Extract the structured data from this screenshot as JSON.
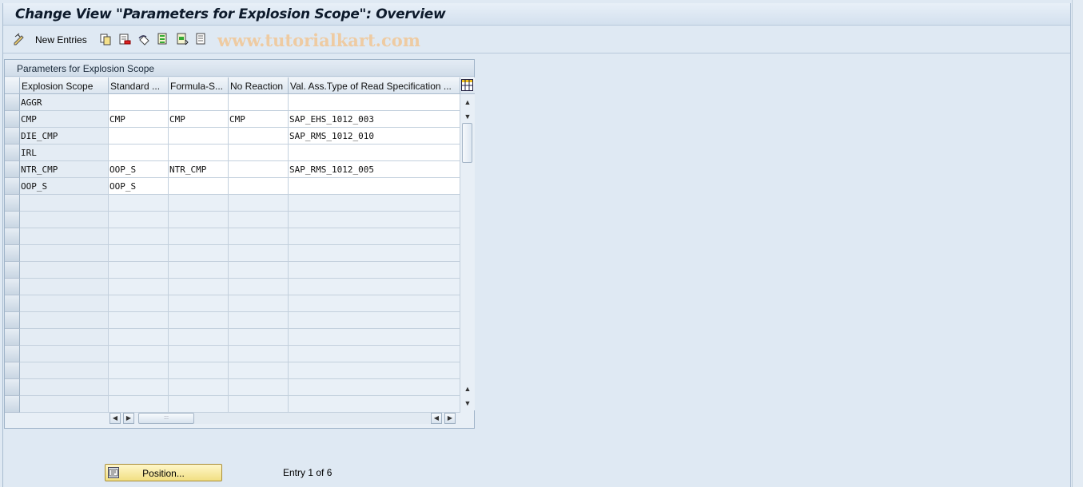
{
  "window": {
    "title": "Change View \"Parameters for Explosion Scope\": Overview"
  },
  "toolbar": {
    "new_entries_label": "New Entries",
    "icons": [
      "edit-toggle-icon",
      "copy-icon",
      "delete-icon",
      "undo-icon",
      "select-all-icon",
      "select-block-icon",
      "deselect-all-icon"
    ],
    "watermark": "www.tutorialkart.com"
  },
  "table": {
    "title": "Parameters for Explosion Scope",
    "columns": [
      "Explosion Scope",
      "Standard ...",
      "Formula-S...",
      "No Reaction",
      "Val. Ass.Type of Read Specification ..."
    ],
    "rows": [
      [
        "AGGR",
        "",
        "",
        "",
        ""
      ],
      [
        "CMP",
        "CMP",
        "CMP",
        "CMP",
        "SAP_EHS_1012_003"
      ],
      [
        "DIE_CMP",
        "",
        "",
        "",
        "SAP_RMS_1012_010"
      ],
      [
        "IRL",
        "",
        "",
        "",
        ""
      ],
      [
        "NTR_CMP",
        "OOP_S",
        "NTR_CMP",
        "",
        "SAP_RMS_1012_005"
      ],
      [
        "OOP_S",
        "OOP_S",
        "",
        "",
        ""
      ]
    ]
  },
  "footer": {
    "position_button_label": "Position...",
    "entry_text": "Entry 1 of 6"
  },
  "colors": {
    "background": "#dfe9f3",
    "position_button": "#f4e391"
  }
}
